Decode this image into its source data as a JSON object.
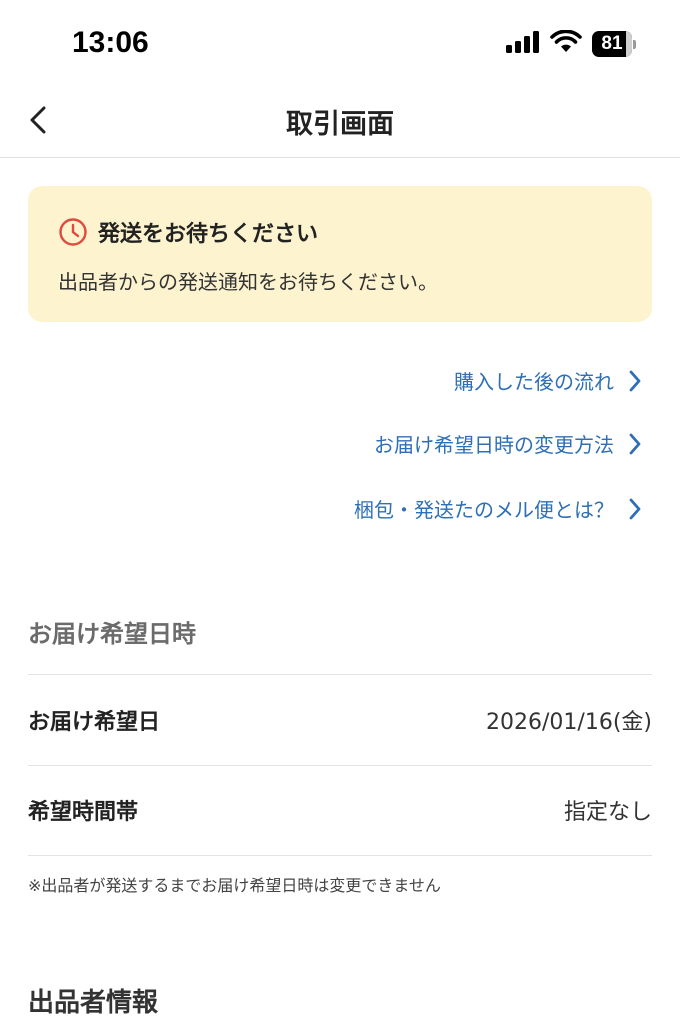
{
  "status_bar": {
    "time": "13:06",
    "battery_level": "81",
    "icons": [
      "signal-icon",
      "wifi-icon",
      "battery-icon"
    ]
  },
  "nav": {
    "title": "取引画面",
    "back_icon": "chevron-left-icon"
  },
  "notice": {
    "icon": "clock-icon",
    "title": "発送をお待ちください",
    "body": "出品者からの発送通知をお待ちください。",
    "bg_color": "#fdf3cf",
    "icon_color": "#e0493f"
  },
  "links": [
    {
      "label": "購入した後の流れ"
    },
    {
      "label": "お届け希望日時の変更方法"
    },
    {
      "label": "梱包・発送たのメル便とは？"
    }
  ],
  "link_color": "#2e6fb5",
  "delivery": {
    "heading": "お届け希望日時",
    "rows": [
      {
        "label": "お届け希望日",
        "value": "2026/01/16(金)"
      },
      {
        "label": "希望時間帯",
        "value": "指定なし"
      }
    ],
    "note": "※出品者が発送するまでお届け希望日時は変更できません"
  },
  "seller": {
    "heading": "出品者情報"
  }
}
